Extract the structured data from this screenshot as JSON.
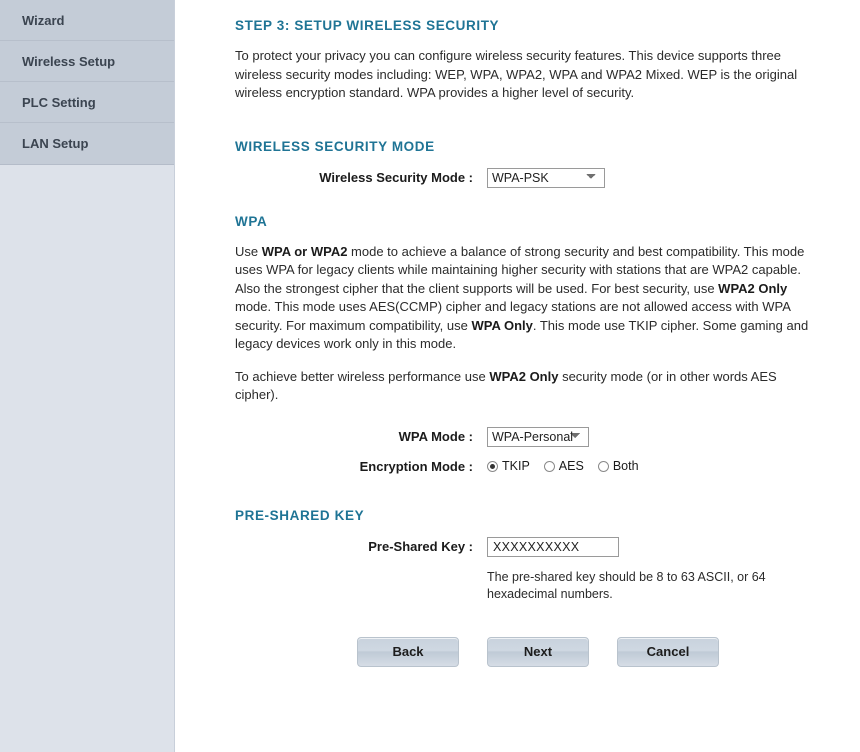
{
  "sidebar": {
    "items": [
      {
        "label": "Wizard"
      },
      {
        "label": "Wireless Setup"
      },
      {
        "label": "PLC Setting"
      },
      {
        "label": "LAN Setup"
      }
    ]
  },
  "main": {
    "page_heading": "STEP 3: SETUP WIRELESS SECURITY",
    "intro_paragraph": "To protect your privacy you can configure wireless security features. This device supports three wireless security modes including: WEP, WPA, WPA2, WPA and WPA2 Mixed. WEP is the original wireless encryption standard. WPA provides a higher level of security.",
    "security_mode_section": {
      "title": "WIRELESS SECURITY MODE",
      "label": "Wireless Security Mode :",
      "value": "WPA-PSK",
      "options": [
        "WPA-PSK"
      ]
    },
    "wpa_section": {
      "title": "WPA",
      "paragraph1_part1": "Use ",
      "paragraph1_bold1": "WPA or WPA2",
      "paragraph1_part2": " mode to achieve a balance of strong security and best compatibility. This mode uses WPA for legacy clients while maintaining higher security with stations that are WPA2 capable. Also the strongest cipher that the client supports will be used. For best security, use ",
      "paragraph1_bold2": "WPA2 Only",
      "paragraph1_part3": " mode. This mode uses AES(CCMP) cipher and legacy stations are not allowed access with WPA security. For maximum compatibility, use ",
      "paragraph1_bold3": "WPA Only",
      "paragraph1_part4": ". This mode use TKIP cipher. Some gaming and legacy devices work only in this mode.",
      "paragraph2_part1": "To achieve better wireless performance use ",
      "paragraph2_bold1": "WPA2 Only",
      "paragraph2_part2": " security mode (or in other words AES cipher).",
      "wpa_mode_label": "WPA Mode :",
      "wpa_mode_value": "WPA-Personal",
      "wpa_mode_options": [
        "WPA-Personal"
      ],
      "encryption_label": "Encryption Mode :",
      "encryption_options": [
        {
          "label": "TKIP",
          "selected": true
        },
        {
          "label": "AES",
          "selected": false
        },
        {
          "label": "Both",
          "selected": false
        }
      ]
    },
    "psk_section": {
      "title": "PRE-SHARED KEY",
      "label": "Pre-Shared Key :",
      "value": "XXXXXXXXXX",
      "hint": "The pre-shared key should be 8 to 63 ASCII, or 64 hexadecimal numbers."
    },
    "buttons": {
      "back": "Back",
      "next": "Next",
      "cancel": "Cancel"
    }
  },
  "colors": {
    "heading_teal": "#1f7495",
    "sidebar_menu_bg": "#c4ccd7",
    "sidebar_bg": "#dde2ea",
    "button_face": "#cfd8e2"
  }
}
